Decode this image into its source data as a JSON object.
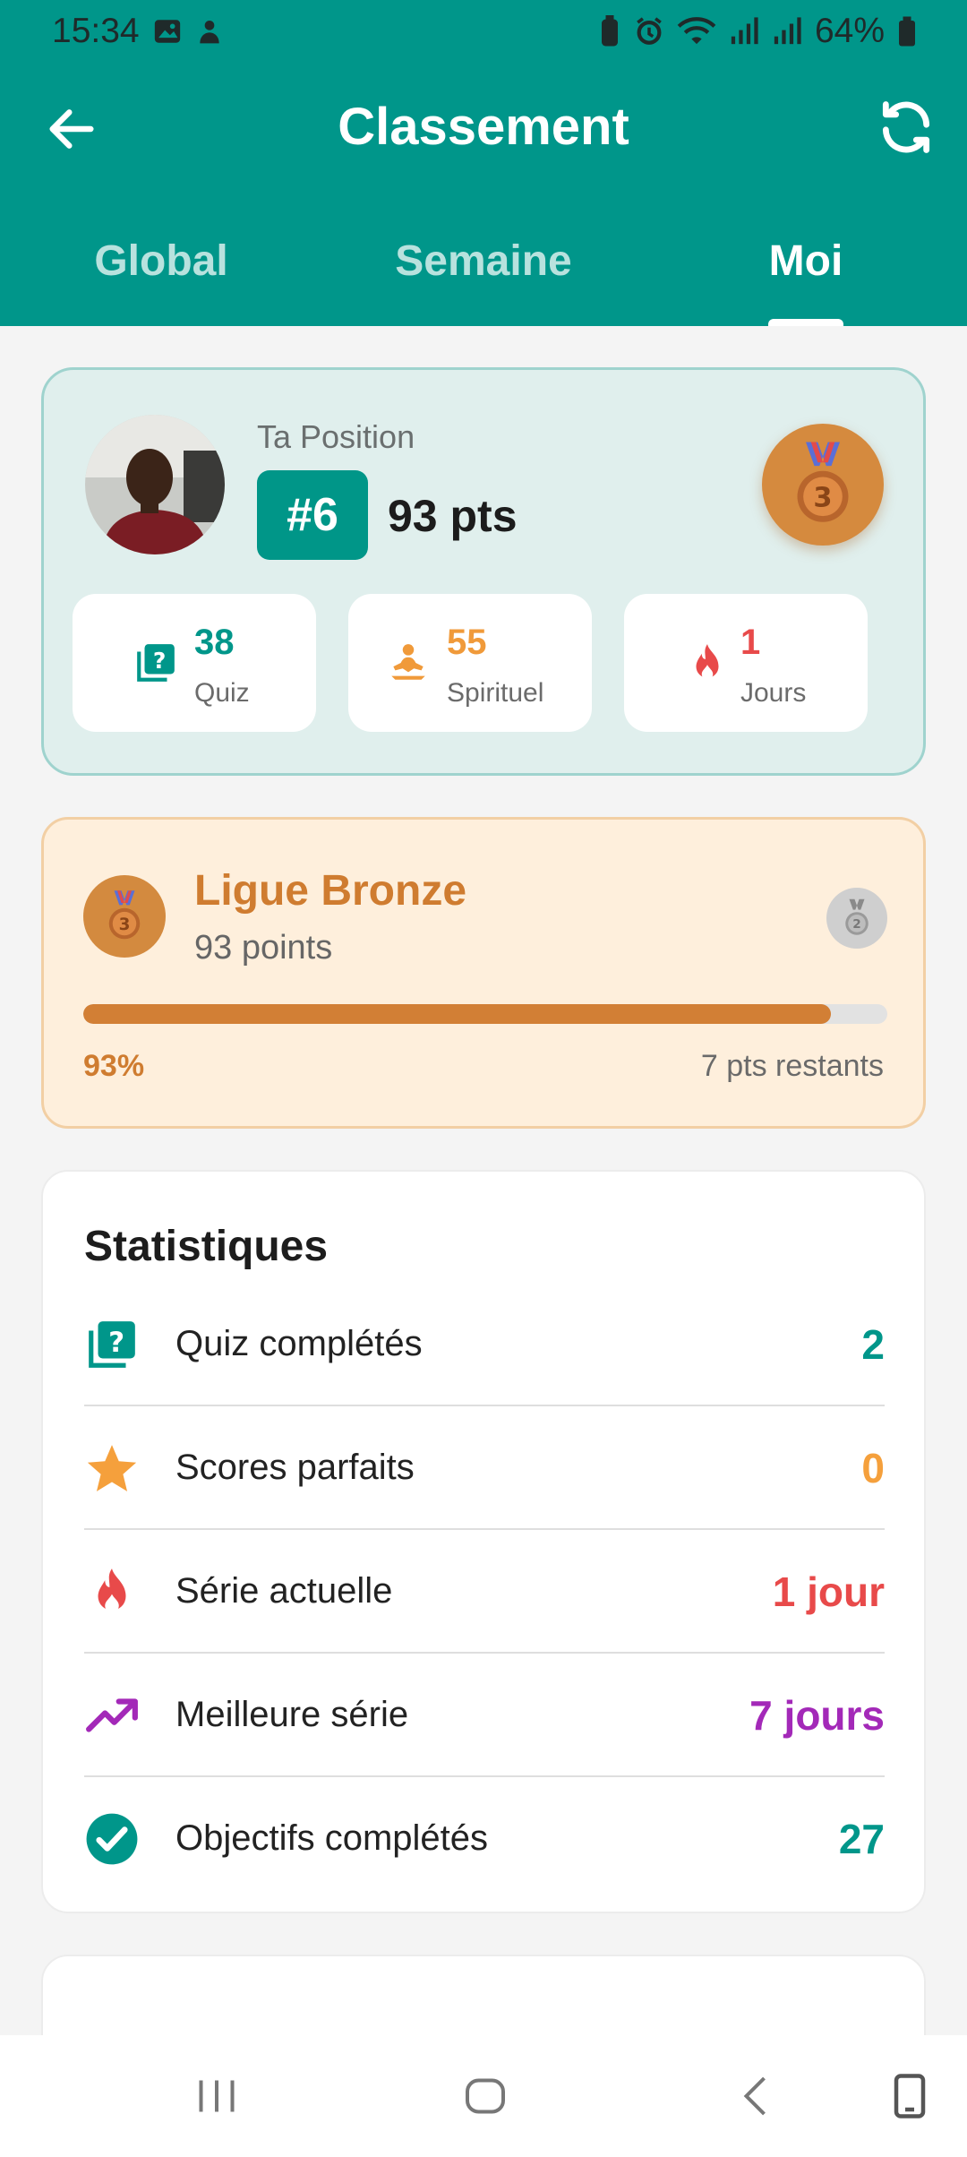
{
  "status_bar": {
    "time": "15:34",
    "battery": "64%"
  },
  "header": {
    "title": "Classement"
  },
  "tabs": [
    {
      "label": "Global"
    },
    {
      "label": "Semaine"
    },
    {
      "label": "Moi"
    }
  ],
  "position_card": {
    "label": "Ta Position",
    "rank": "#6",
    "points": "93 pts",
    "medal_rank": "3",
    "mini_stats": [
      {
        "value": "38",
        "label": "Quiz",
        "icon": "quiz-icon",
        "color": "#00968a"
      },
      {
        "value": "55",
        "label": "Spirituel",
        "icon": "meditation-icon",
        "color": "#f09a3a"
      },
      {
        "value": "1",
        "label": "Jours",
        "icon": "fire-icon",
        "color": "#e84a4a"
      }
    ]
  },
  "league_card": {
    "name": "Ligue Bronze",
    "points": "93 points",
    "progress_percent": 93,
    "progress_label": "93%",
    "remaining": "7 pts restants",
    "current_medal": "3",
    "next_medal": "2"
  },
  "stats_card": {
    "title": "Statistiques",
    "rows": [
      {
        "label": "Quiz complétés",
        "value": "2",
        "icon": "quiz-icon",
        "color": "#00968a"
      },
      {
        "label": "Scores parfaits",
        "value": "0",
        "icon": "star-icon",
        "color": "#f5a03c"
      },
      {
        "label": "Série actuelle",
        "value": "1 jour",
        "icon": "fire-icon",
        "color": "#e84a4a"
      },
      {
        "label": "Meilleure série",
        "value": "7 jours",
        "icon": "trending-up-icon",
        "color": "#a329b8"
      },
      {
        "label": "Objectifs complétés",
        "value": "27",
        "icon": "check-circle-icon",
        "color": "#00968a"
      }
    ]
  },
  "colors": {
    "primary": "#00968a",
    "bronze": "#d27f35",
    "league_bg": "#feefdc"
  }
}
